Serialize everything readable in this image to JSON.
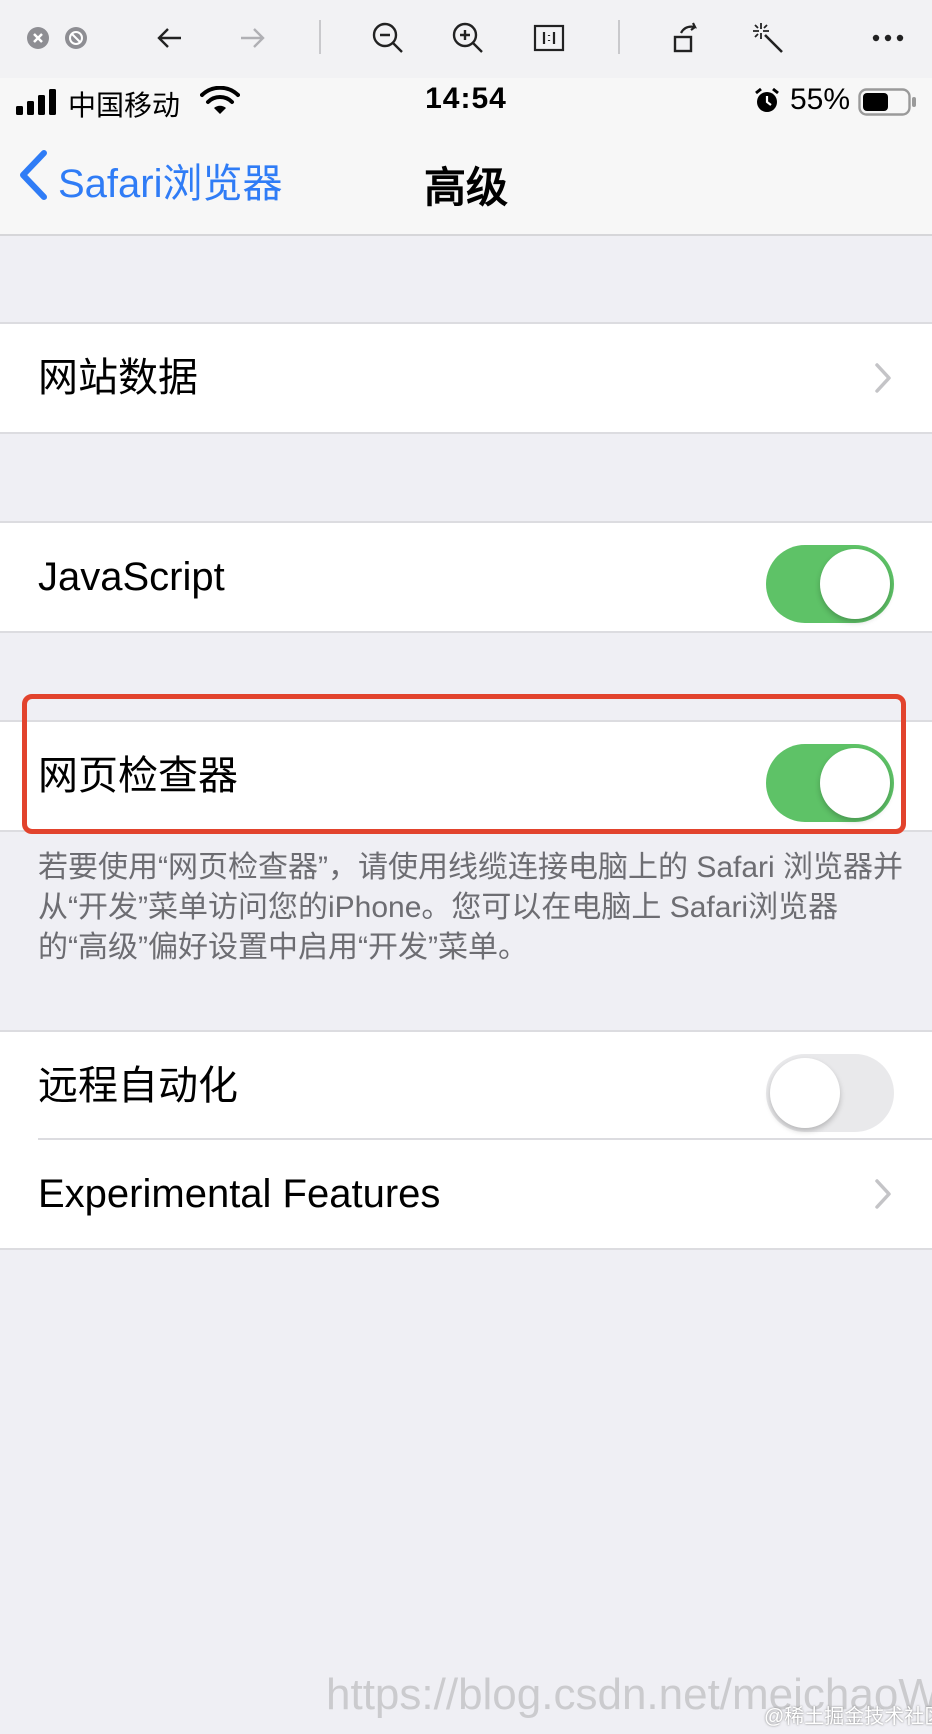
{
  "toolbar": {
    "icons": [
      "close-icon",
      "block-icon",
      "back-arrow-icon",
      "forward-arrow-icon",
      "zoom-out-icon",
      "zoom-in-icon",
      "actual-size-icon",
      "rotate-icon",
      "magic-wand-icon",
      "more-icon"
    ]
  },
  "statusbar": {
    "carrier": "中国移动",
    "time": "14:54",
    "battery_percent": "55%"
  },
  "navbar": {
    "back_label": "Safari浏览器",
    "title": "高级"
  },
  "cells": {
    "website_data": {
      "label": "网站数据"
    },
    "javascript": {
      "label": "JavaScript",
      "on": true
    },
    "web_inspector": {
      "label": "网页检查器",
      "on": true
    },
    "remote_automation": {
      "label": "远程自动化",
      "on": false
    },
    "experimental": {
      "label": "Experimental Features"
    }
  },
  "footnote": "若要使用“网页检查器”，请使用线缆连接电脑上的 Safari 浏览器并从“开发”菜单访问您的iPhone。您可以在电脑上 Safari浏览器的“高级”偏好设置中启用“开发”菜单。",
  "watermark": {
    "url": "https://blog.csdn.net/meichaoWen",
    "community": "@稀土掘金技术社区"
  },
  "colors": {
    "accent": "#2f7cf6",
    "toggle_on": "#5ec267",
    "highlight": "#e2432d"
  }
}
